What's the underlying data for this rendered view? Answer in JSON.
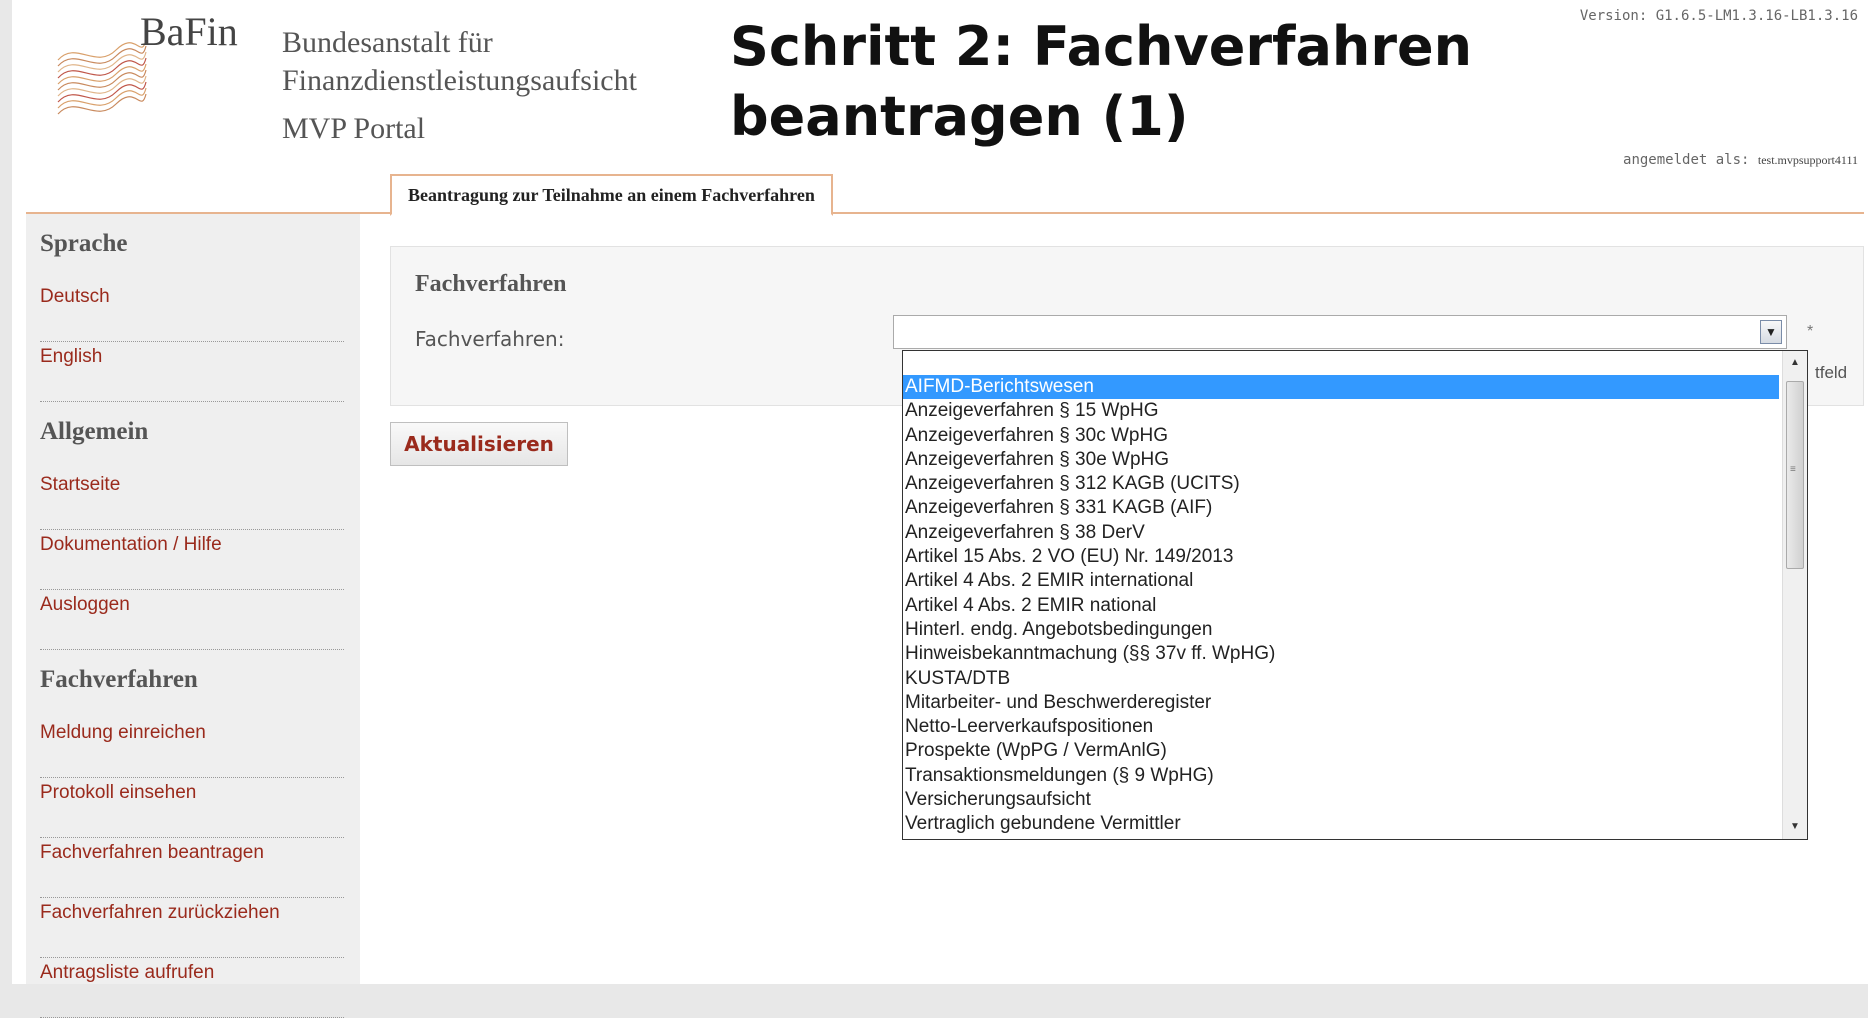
{
  "header": {
    "brand": "BaFin",
    "institution_line1": "Bundesanstalt für",
    "institution_line2": "Finanzdienstleistungsaufsicht",
    "portal": "MVP Portal",
    "slide_title_line1": "Schritt 2: Fachverfahren",
    "slide_title_line2": "beantragen (1)",
    "version": "Version: G1.6.5-LM1.3.16-LB1.3.16",
    "logged_in_label": "angemeldet als:",
    "logged_in_user": "test.mvpsupport4111"
  },
  "tab": {
    "label": "Beantragung zur Teilnahme an einem Fachverfahren"
  },
  "sidebar": {
    "sections": [
      {
        "heading": "Sprache",
        "items": [
          "Deutsch",
          "English"
        ]
      },
      {
        "heading": "Allgemein",
        "items": [
          "Startseite",
          "Dokumentation / Hilfe",
          "Ausloggen"
        ]
      },
      {
        "heading": "Fachverfahren",
        "items": [
          "Meldung einreichen",
          "Protokoll einsehen",
          "Fachverfahren beantragen",
          "Fachverfahren zurückziehen",
          "Antragsliste aufrufen"
        ]
      }
    ]
  },
  "form": {
    "panel_title": "Fachverfahren",
    "field_label": "Fachverfahren:",
    "selected_value": "",
    "required_marker": "*",
    "hint_fragment": "tfeld",
    "submit_label": "Aktualisieren"
  },
  "dropdown": {
    "selected_index": 0,
    "options": [
      "AIFMD-Berichtswesen",
      "Anzeigeverfahren § 15 WpHG",
      "Anzeigeverfahren § 30c WpHG",
      "Anzeigeverfahren § 30e WpHG",
      "Anzeigeverfahren § 312 KAGB (UCITS)",
      "Anzeigeverfahren § 331 KAGB (AIF)",
      "Anzeigeverfahren § 38 DerV",
      "Artikel 15 Abs. 2 VO (EU) Nr. 149/2013",
      "Artikel 4 Abs. 2 EMIR international",
      "Artikel 4 Abs. 2 EMIR national",
      "Hinterl. endg. Angebotsbedingungen",
      "Hinweisbekanntmachung (§§ 37v ff. WpHG)",
      "KUSTA/DTB",
      "Mitarbeiter- und Beschwerderegister",
      "Netto-Leerverkaufspositionen",
      "Prospekte (WpPG / VermAnlG)",
      "Transaktionsmeldungen (§ 9 WpHG)",
      "Versicherungsaufsicht",
      "Vertraglich gebundene Vermittler"
    ]
  },
  "colors": {
    "link": "#9a2a1c",
    "accent_line": "#e7b48f",
    "selection": "#3399ff"
  }
}
